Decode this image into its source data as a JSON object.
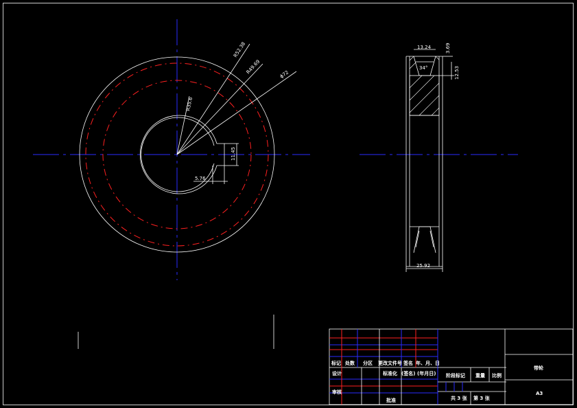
{
  "dimensions": {
    "radius_outer": "R52.38",
    "radius_pitch": "R49.69",
    "radius_inner": "R35.6",
    "dia_outer": "ϕ72",
    "keyway_width": "11.45",
    "keyway_depth": "5.76",
    "groove_top": "13.24",
    "groove_depth_a": "3.69",
    "groove_depth_b": "12.53",
    "groove_angle": "34°",
    "width": "25.92"
  },
  "title_block": {
    "row_label_mark": "标记",
    "row_label_count": "处数",
    "row_label_zone": "分区",
    "row_label_doc": "更改文件号",
    "row_label_sign": "签名",
    "row_label_date": "年、月、日",
    "design": "设计",
    "standardize": "标准化",
    "sign_name": "(签名)",
    "sign_date": "(年月日)",
    "stage_mark": "阶段标记",
    "weight": "重量",
    "scale": "比例",
    "review": "审核",
    "approve": "批准",
    "sheets_total": "共 3 张",
    "sheet_no": "第 3 张",
    "part_name": "带轮",
    "paper_size": "A3"
  }
}
